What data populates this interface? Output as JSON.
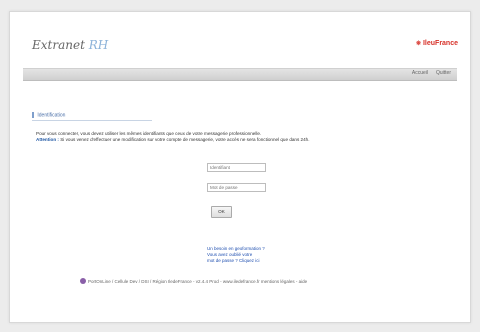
{
  "header": {
    "title_main": "Extranet",
    "title_accent": "RH",
    "logo_mark": "❊",
    "logo_text": "IleuFrance"
  },
  "menu": {
    "items": [
      "Accueil",
      "Quitter"
    ]
  },
  "section": {
    "title": "Identification"
  },
  "intro": {
    "line1": "Pour vous connecter, vous devez utiliser les mêmes identifiants que ceux de votre messagerie professionnelle.",
    "warning_label": "Attention :",
    "warning_text": " Si vous venez d'effectuer une modification sur votre compte de messagerie, votre accès ne sera fonctionnel que dans 24h."
  },
  "form": {
    "login_placeholder": "Identifiant",
    "password_placeholder": "Mot de passe",
    "ok_label": "OK"
  },
  "help": {
    "links": [
      "Un besoin en geoformation ?",
      "Vous avez oublié votre",
      "mot de passe ? Cliquez ici"
    ]
  },
  "footer": {
    "text": "PortOnLine / Cellule Dev / DSI / Région IledeFrance - v2.4.4 Prod - www.iledefrance.fr mentions légales - aide"
  },
  "colors": {
    "accent_rh": "#8db3d9",
    "logo_red": "#d7322a",
    "link_blue": "#1f4fb0",
    "footer_icon": "#8a5fa8"
  }
}
